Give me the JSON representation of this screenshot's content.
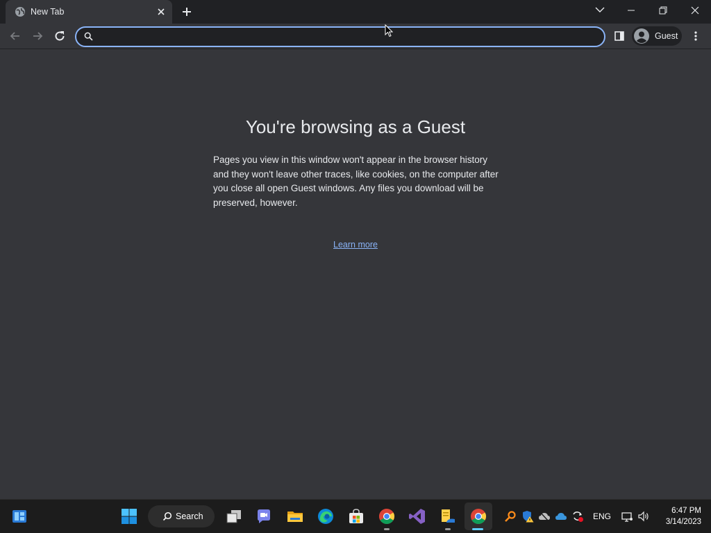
{
  "browser": {
    "tab": {
      "title": "New Tab"
    },
    "omnibox": {
      "value": "",
      "placeholder": ""
    },
    "profile": {
      "label": "Guest"
    }
  },
  "page": {
    "heading": "You're browsing as a Guest",
    "description": "Pages you view in this window won't appear in the browser history and they won't leave other traces, like cookies, on the computer after you close all open Guest windows. Any files you download will be preserved, however.",
    "learn_more": "Learn more"
  },
  "taskbar": {
    "search_label": "Search",
    "language": "ENG",
    "time": "6:47 PM",
    "date": "3/14/2023",
    "apps": [
      "widgets",
      "start",
      "search",
      "task-view",
      "teams-chat",
      "file-explorer",
      "edge",
      "microsoft-store",
      "chrome",
      "visual-studio",
      "notepad-app",
      "chrome-active"
    ]
  },
  "colors": {
    "page_bg": "#35363a",
    "titlebar_bg": "#202124",
    "accent": "#8ab4f8",
    "taskbar_bg": "#1c1c1c",
    "active_indicator": "#60cdff"
  }
}
